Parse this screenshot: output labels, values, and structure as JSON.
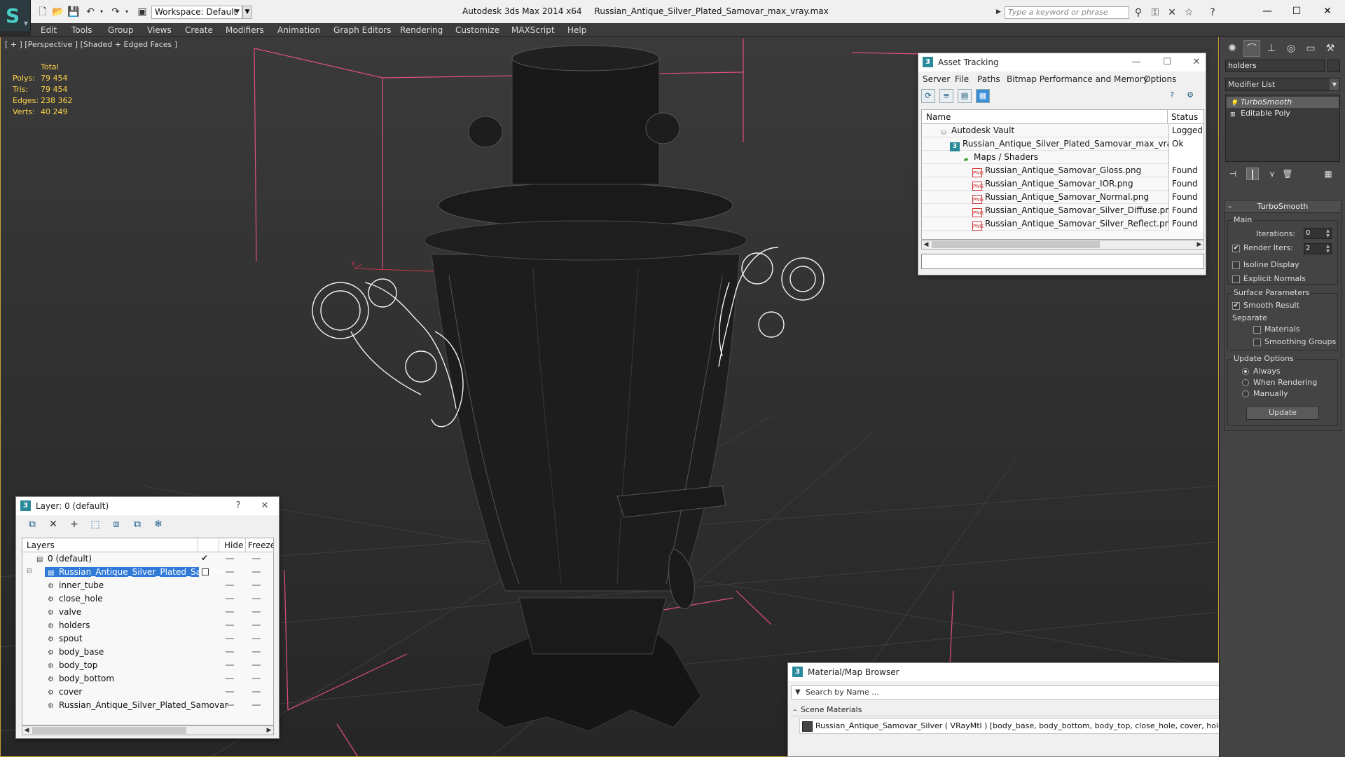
{
  "titlebar": {
    "workspace": "Workspace: Default",
    "app_name": "Autodesk 3ds Max  2014 x64",
    "file_name": "Russian_Antique_Silver_Plated_Samovar_max_vray.max",
    "search_placeholder": "Type a keyword or phrase"
  },
  "menu": [
    "Edit",
    "Tools",
    "Group",
    "Views",
    "Create",
    "Modifiers",
    "Animation",
    "Graph Editors",
    "Rendering",
    "Customize",
    "MAXScript",
    "Help"
  ],
  "viewport": {
    "label": "[ + ] [Perspective ] [Shaded + Edged Faces ]",
    "stats": {
      "header": "Total",
      "rows": [
        {
          "label": "Polys:",
          "value": "79 454"
        },
        {
          "label": "Tris:",
          "value": "79 454"
        },
        {
          "label": "Edges:",
          "value": "238 362"
        },
        {
          "label": "Verts:",
          "value": "40 249"
        }
      ]
    }
  },
  "asset_tracking": {
    "title": "Asset Tracking",
    "menu": [
      "Server",
      "File",
      "Paths",
      "Bitmap Performance and Memory",
      "Options"
    ],
    "col_name": "Name",
    "col_status": "Status",
    "rows": [
      {
        "name": "Autodesk Vault",
        "status": "Logged",
        "icon": "vault-icon",
        "indent": 1
      },
      {
        "name": "Russian_Antique_Silver_Plated_Samovar_max_vray.max",
        "status": "Ok",
        "icon": "max-file-icon",
        "indent": 2
      },
      {
        "name": "Maps / Shaders",
        "status": "",
        "icon": "folder-icon",
        "indent": 3
      },
      {
        "name": "Russian_Antique_Samovar_Gloss.png",
        "status": "Found",
        "icon": "png-icon",
        "indent": 4
      },
      {
        "name": "Russian_Antique_Samovar_IOR.png",
        "status": "Found",
        "icon": "png-icon",
        "indent": 4
      },
      {
        "name": "Russian_Antique_Samovar_Normal.png",
        "status": "Found",
        "icon": "png-icon",
        "indent": 4
      },
      {
        "name": "Russian_Antique_Samovar_Silver_Diffuse.png",
        "status": "Found",
        "icon": "png-icon",
        "indent": 4
      },
      {
        "name": "Russian_Antique_Samovar_Silver_Reflect.png",
        "status": "Found",
        "icon": "png-icon",
        "indent": 4
      }
    ]
  },
  "layers": {
    "title": "Layer: 0 (default)",
    "col_layers": "Layers",
    "col_hide": "Hide",
    "col_freeze": "Freeze",
    "rows": [
      {
        "name": "0 (default)",
        "level": 1,
        "selected": false,
        "current": true
      },
      {
        "name": "Russian_Antique_Silver_Plated_Samovar",
        "level": 1,
        "selected": true,
        "current": false
      },
      {
        "name": "inner_tube",
        "level": 2
      },
      {
        "name": "close_hole",
        "level": 2
      },
      {
        "name": "valve",
        "level": 2
      },
      {
        "name": "holders",
        "level": 2
      },
      {
        "name": "spout",
        "level": 2
      },
      {
        "name": "body_base",
        "level": 2
      },
      {
        "name": "body_top",
        "level": 2
      },
      {
        "name": "body_bottom",
        "level": 2
      },
      {
        "name": "cover",
        "level": 2
      },
      {
        "name": "Russian_Antique_Silver_Plated_Samovar",
        "level": 2
      }
    ]
  },
  "material_browser": {
    "title": "Material/Map Browser",
    "search_placeholder": "Search by Name ...",
    "section": "Scene Materials",
    "item": "Russian_Antique_Samovar_Silver ( VRayMtl ) [body_base, body_bottom, body_top, close_hole, cover, holders, inner_tube, spout, valve]"
  },
  "command_panel": {
    "object_name": "holders",
    "modifier_list": "Modifier List",
    "stack": [
      {
        "name": "TurboSmooth",
        "selected": true
      },
      {
        "name": "Editable Poly",
        "selected": false
      }
    ],
    "turbosmooth": {
      "title": "TurboSmooth",
      "main_group": "Main",
      "iterations_label": "Iterations:",
      "iterations_value": "0",
      "render_iters_label": "Render Iters:",
      "render_iters_value": "2",
      "render_iters_checked": true,
      "isoline_label": "Isoline Display",
      "isoline_checked": false,
      "explicit_normals_label": "Explicit Normals",
      "explicit_normals_checked": false,
      "surface_group": "Surface Parameters",
      "smooth_result_label": "Smooth Result",
      "smooth_result_checked": true,
      "separate_label": "Separate",
      "materials_label": "Materials",
      "smoothing_groups_label": "Smoothing Groups",
      "update_group": "Update Options",
      "always_label": "Always",
      "when_rendering_label": "When Rendering",
      "manually_label": "Manually",
      "update_mode": "Always",
      "update_button": "Update"
    }
  },
  "colors": {
    "stats_text": "#ffd54a",
    "selection_blue": "#2f7ad6",
    "viewport_border": "#c9a23a",
    "bounding_box": "#e0507a",
    "material_swatch": "#e00000"
  }
}
